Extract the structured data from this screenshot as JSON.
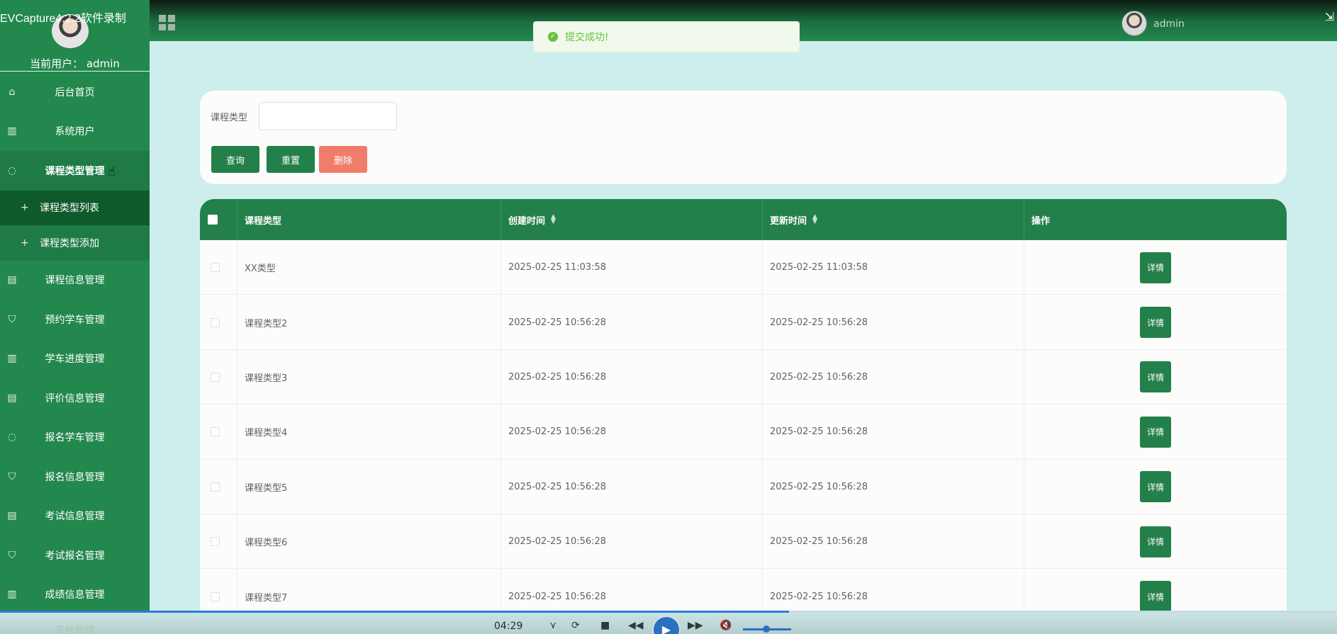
{
  "recorder": {
    "title": "EVCapture4.2.2软件录制",
    "time": "04:29",
    "progress_fraction": 0.59
  },
  "header": {
    "username": "admin",
    "menu_icon": "grid-icon",
    "avatar_icon": "avatar"
  },
  "toast": {
    "message": "提交成功!",
    "icon": "check-circle-icon"
  },
  "sidebar": {
    "current_user_label": "当前用户：",
    "current_user": "admin",
    "items": [
      {
        "label": "后台首页",
        "icon": "home-icon"
      },
      {
        "label": "系统用户",
        "icon": "columns-icon"
      },
      {
        "label": "课程类型管理",
        "icon": "chat-icon",
        "active": true,
        "children": [
          {
            "label": "课程类型列表",
            "current": true
          },
          {
            "label": "课程类型添加"
          }
        ]
      },
      {
        "label": "课程信息管理",
        "icon": "document-icon"
      },
      {
        "label": "预约学车管理",
        "icon": "shield-icon"
      },
      {
        "label": "学车进度管理",
        "icon": "columns-icon"
      },
      {
        "label": "评价信息管理",
        "icon": "document-icon"
      },
      {
        "label": "报名学车管理",
        "icon": "chat-icon"
      },
      {
        "label": "报名信息管理",
        "icon": "shield-icon"
      },
      {
        "label": "考试信息管理",
        "icon": "document-icon"
      },
      {
        "label": "考试报名管理",
        "icon": "shield-icon"
      },
      {
        "label": "成绩信息管理",
        "icon": "columns-icon"
      }
    ],
    "cut_off_item": "系统管理"
  },
  "search": {
    "label": "课程类型",
    "value": "",
    "placeholder": "",
    "query_label": "查询",
    "reset_label": "重置",
    "delete_label": "删除"
  },
  "table": {
    "columns": [
      "课程类型",
      "创建时间",
      "更新时间",
      "操作"
    ],
    "detail_label": "详情",
    "rows": [
      {
        "type": "XX类型",
        "created": "2025-02-25 11:03:58",
        "updated": "2025-02-25 11:03:58"
      },
      {
        "type": "课程类型2",
        "created": "2025-02-25 10:56:28",
        "updated": "2025-02-25 10:56:28"
      },
      {
        "type": "课程类型3",
        "created": "2025-02-25 10:56:28",
        "updated": "2025-02-25 10:56:28"
      },
      {
        "type": "课程类型4",
        "created": "2025-02-25 10:56:28",
        "updated": "2025-02-25 10:56:28"
      },
      {
        "type": "课程类型5",
        "created": "2025-02-25 10:56:28",
        "updated": "2025-02-25 10:56:28"
      },
      {
        "type": "课程类型6",
        "created": "2025-02-25 10:56:28",
        "updated": "2025-02-25 10:56:28"
      },
      {
        "type": "课程类型7",
        "created": "2025-02-25 10:56:28",
        "updated": "2025-02-25 10:56:28"
      }
    ]
  },
  "colors": {
    "primary": "#23804a",
    "sidebar": "#23884d",
    "danger": "#f07c6c",
    "background": "#cdeeed",
    "success": "#67c23a"
  }
}
